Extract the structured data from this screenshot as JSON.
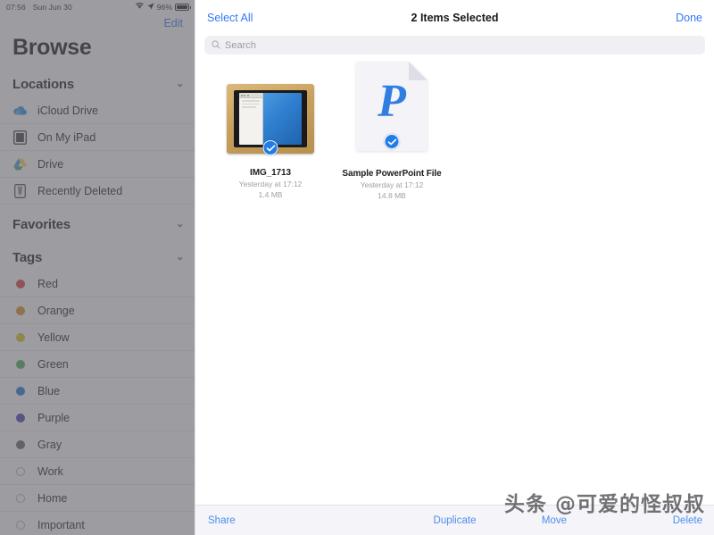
{
  "status_bar": {
    "time": "07:56",
    "date": "Sun Jun 30",
    "battery_percent": "96%",
    "wifi_icon": "wifi-icon",
    "location_icon": "location-arrow-icon",
    "battery_icon": "battery-icon"
  },
  "sidebar": {
    "edit_label": "Edit",
    "title": "Browse",
    "sections": [
      {
        "header": "Locations",
        "chevron": "⌄",
        "items": [
          {
            "label": "iCloud Drive",
            "icon": "icloud-drive-icon"
          },
          {
            "label": "On My iPad",
            "icon": "ipad-icon"
          },
          {
            "label": "Drive",
            "icon": "google-drive-icon"
          },
          {
            "label": "Recently Deleted",
            "icon": "trash-icon"
          }
        ]
      },
      {
        "header": "Favorites",
        "chevron": "⌄",
        "items": []
      },
      {
        "header": "Tags",
        "chevron": "⌄",
        "items": [
          {
            "label": "Red",
            "icon": "tag-dot-red",
            "color": "#d63b36",
            "filled": true
          },
          {
            "label": "Orange",
            "icon": "tag-dot-orange",
            "color": "#d2891a",
            "filled": true
          },
          {
            "label": "Yellow",
            "icon": "tag-dot-yellow",
            "color": "#d6bb22",
            "filled": true
          },
          {
            "label": "Green",
            "icon": "tag-dot-green",
            "color": "#43a94a",
            "filled": true
          },
          {
            "label": "Blue",
            "icon": "tag-dot-blue",
            "color": "#1f6fd0",
            "filled": true
          },
          {
            "label": "Purple",
            "icon": "tag-dot-purple",
            "color": "#3f3aa8",
            "filled": true
          },
          {
            "label": "Gray",
            "icon": "tag-dot-gray",
            "color": "#5e5e66",
            "filled": true
          },
          {
            "label": "Work",
            "icon": "tag-ring-work",
            "color": "",
            "filled": false
          },
          {
            "label": "Home",
            "icon": "tag-ring-home",
            "color": "",
            "filled": false
          },
          {
            "label": "Important",
            "icon": "tag-ring-important",
            "color": "",
            "filled": false
          }
        ]
      }
    ]
  },
  "toolbar": {
    "select_all_label": "Select All",
    "title": "2 Items Selected",
    "done_label": "Done"
  },
  "search": {
    "placeholder": "Search",
    "value": "",
    "icon": "search-icon"
  },
  "files": [
    {
      "name": "IMG_1713",
      "modified": "Yesterday at 17:12",
      "size": "1.4 MB",
      "kind": "photo",
      "selected": true,
      "badge_icon": "checkmark-circle-icon"
    },
    {
      "name": "Sample PowerPoint File",
      "modified": "Yesterday at 17:12",
      "size": "14.8 MB",
      "kind": "powerpoint",
      "glyph": "P",
      "selected": true,
      "badge_icon": "checkmark-circle-icon"
    }
  ],
  "bottom_toolbar": {
    "share_label": "Share",
    "duplicate_label": "Duplicate",
    "move_label": "Move",
    "delete_label": "Delete"
  },
  "watermark": "头条 @可爱的怪叔叔",
  "colors": {
    "accent_blue": "#3478f6",
    "badge_blue": "#1f7ce8",
    "toolbar_link": "#4b8ef0",
    "sidebar_bg": "#f7f7f9",
    "main_bg": "#ffffff"
  }
}
